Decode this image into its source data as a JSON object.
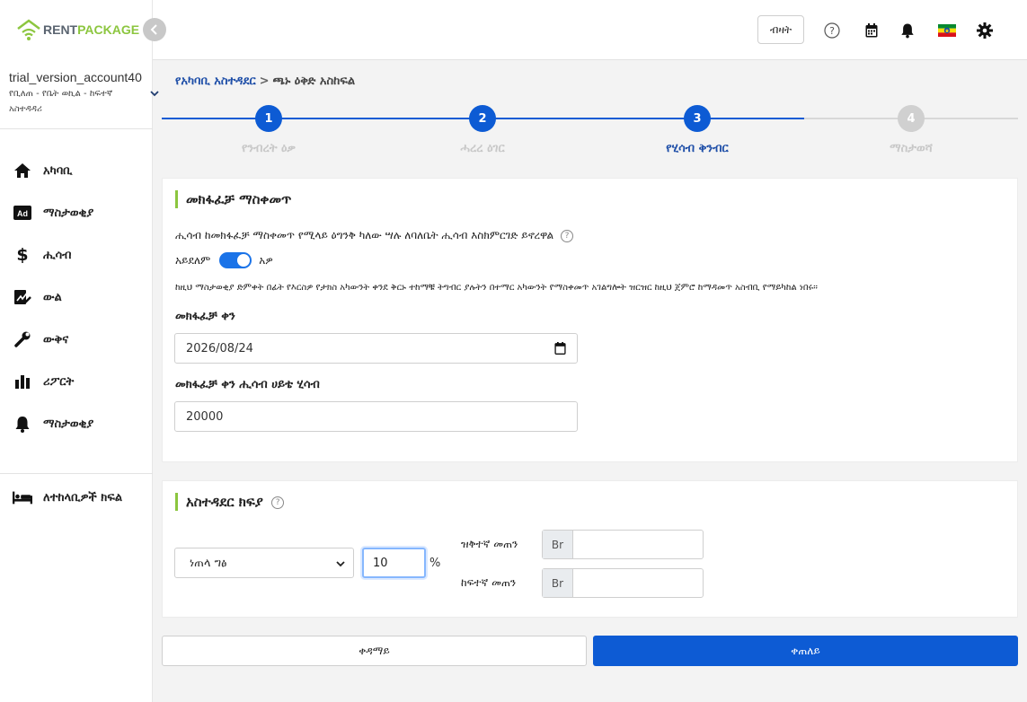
{
  "brand": {
    "part1": "RENT",
    "part2": "PACKAGE",
    "accent": "#8cc63f"
  },
  "account": {
    "name": "trial_version_account40",
    "role": "የቢለጠ - የቤት ወኪል - ከፍተኛ አስተዳዳሪ"
  },
  "sidebar": {
    "items": [
      {
        "label": "አካባቢ",
        "icon": "home-icon"
      },
      {
        "label": "ማስታወቂያ",
        "icon": "ad-icon"
      },
      {
        "label": "ሒሳብ",
        "icon": "dollar-icon"
      },
      {
        "label": "ውል",
        "icon": "contract-icon"
      },
      {
        "label": "ውቅና",
        "icon": "wrench-icon"
      },
      {
        "label": "ሪፖርት",
        "icon": "bar-chart-icon"
      },
      {
        "label": "ማስታወቂያ",
        "icon": "bell-icon"
      }
    ],
    "tenant_item": {
      "label": "ለተከላቢዎች ክፍል",
      "icon": "bed-icon"
    }
  },
  "topbar": {
    "button_label": "ብዛት",
    "accent": "#0d5bd4"
  },
  "breadcrumb": {
    "link": "የአካባቢ አስተዳደር",
    "separator": ">",
    "current": "ጫኑ ዕቅድ አስከፍል"
  },
  "stepper": {
    "steps": [
      {
        "number": "1",
        "label": "የንብረት ዕቃ",
        "state": "done"
      },
      {
        "number": "2",
        "label": "ሓረረ ዕገር",
        "state": "done"
      },
      {
        "number": "3",
        "label": "የሂሳብ ቅንብር",
        "state": "active"
      },
      {
        "number": "4",
        "label": "ማስታወሻ",
        "state": "pending"
      }
    ]
  },
  "billing": {
    "title": "መክፋፈቻ ማስቀመጥ",
    "description": "ሒሳብ ከመክፋፈቻ ማስቀመጥ የሚላይ ዕግንቅ ካለው ሣሉ ለባለቤት ሒሳብ እስክምርገድ ይኖረዋል",
    "toggle_off_label": "አይደለም",
    "toggle_on_label": "አዎ",
    "toggle_value": true,
    "notice": "ከዚህ ማስታወቂያ ድምቀት በፊት የእርስዎ የታክስ አካውንት ቀንደ ቅርኑ ተከማቹ ትግብር ያሉትን በተማር አካውንት የማስቀመጥ አገልግሎት ዝርዝር ከዚህ ጀምሮ ከማዳመጥ አስብቢ የማይካከል ነበሩ።",
    "date_label": "መክፋፈቻ ቀን",
    "date_value": "2026/08/24",
    "amount_label": "መክፋፈቻ ቀን ሒሳብ ሀይቴ ሂሳብ",
    "amount_value": "20000"
  },
  "fee": {
    "title": "አስተዳደር ክፍያ",
    "select_value": "ነጠላ ግፅ",
    "percent_value": "10",
    "percent_sign": "%",
    "min_label": "ዝቅተኛ መጠን",
    "max_label": "ከፍተኛ መጠን",
    "currency": "Br"
  },
  "actions": {
    "back": "ቀዳማይ",
    "next": "ቀጠለይ"
  }
}
